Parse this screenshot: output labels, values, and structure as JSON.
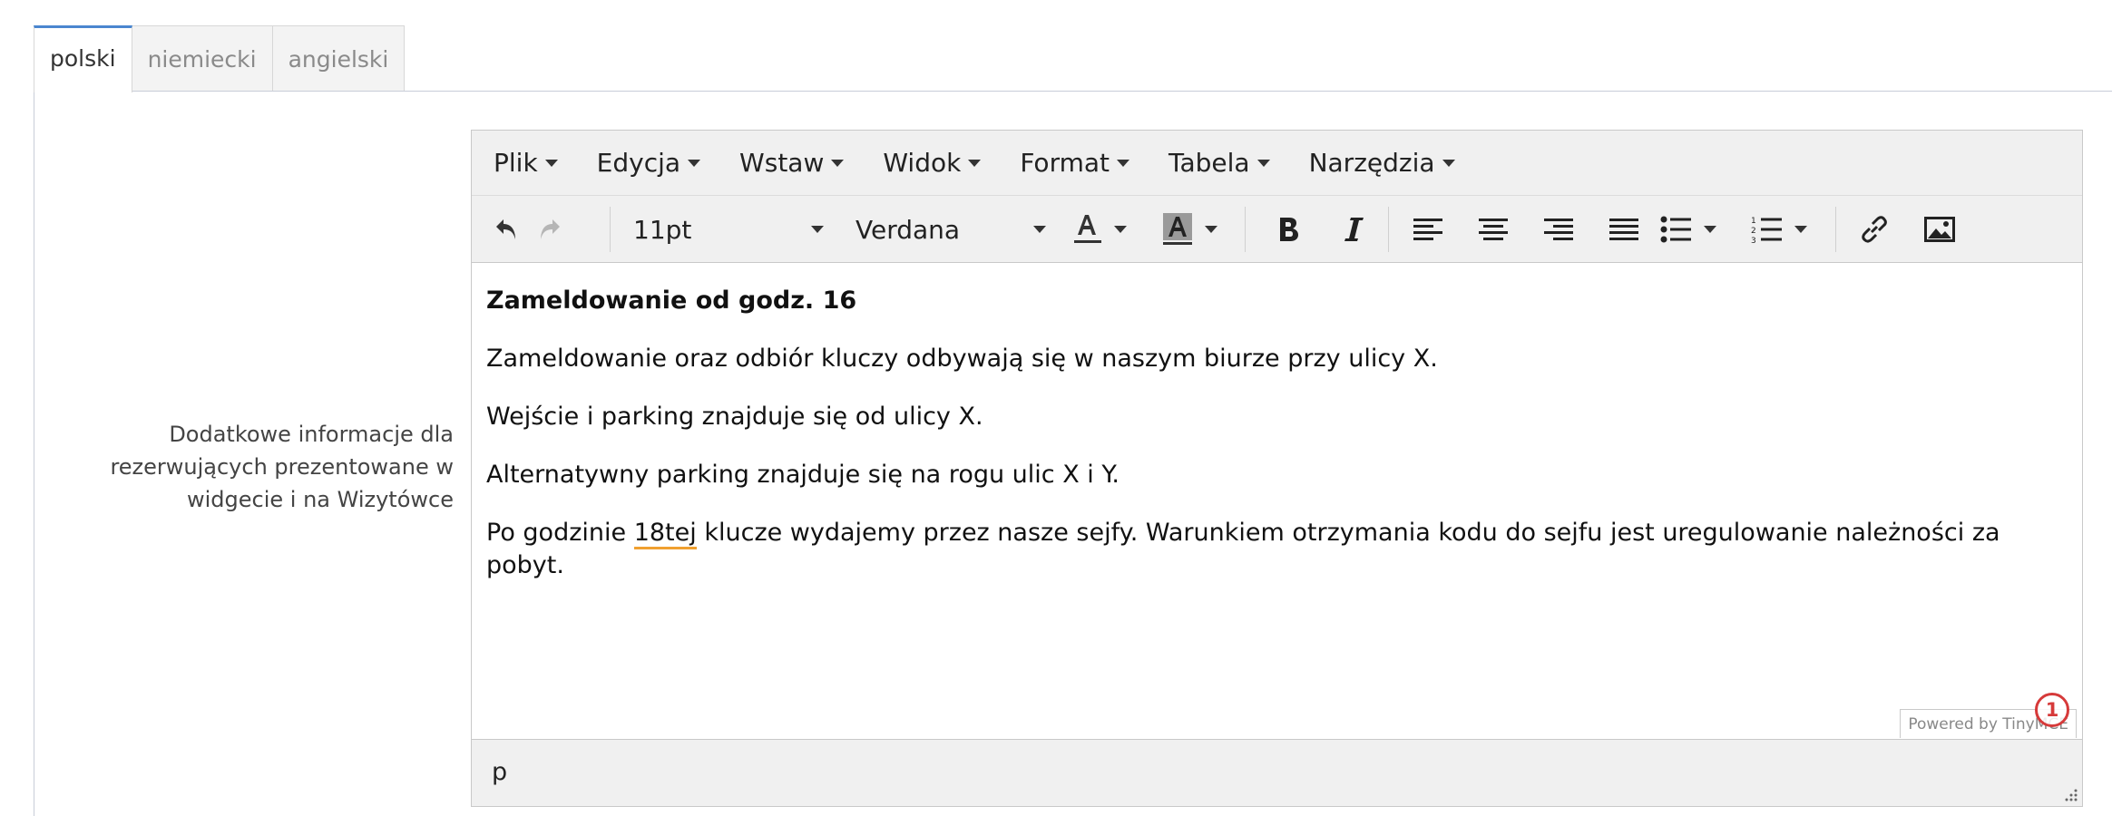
{
  "tabs": [
    {
      "label": "polski",
      "active": true
    },
    {
      "label": "niemiecki",
      "active": false
    },
    {
      "label": "angielski",
      "active": false
    }
  ],
  "field_label": "Dodatkowe informacje dla rezerwujących prezentowane w widgecie i na Wizytówce",
  "editor": {
    "menu": [
      "Plik",
      "Edycja",
      "Wstaw",
      "Widok",
      "Format",
      "Tabela",
      "Narzędzia"
    ],
    "toolbar": {
      "font_size": "11pt",
      "font_family": "Verdana",
      "icons": [
        "undo-icon",
        "redo-icon",
        "text-color-icon",
        "background-color-icon",
        "bold-icon",
        "italic-icon",
        "align-left-icon",
        "align-center-icon",
        "align-right-icon",
        "align-justify-icon",
        "bullet-list-icon",
        "numbered-list-icon",
        "link-icon",
        "image-icon"
      ]
    },
    "content": {
      "heading": "Zameldowanie od godz. 16",
      "p1": "Zameldowanie oraz odbiór kluczy odbywają się w naszym biurze przy ulicy X.",
      "p2": "Wejście i parking znajduje się od ulicy X.",
      "p3": "Alternatywny parking znajduje się na rogu ulic X i Y.",
      "p4_before": "Po godzinie ",
      "p4_misspelled": "18tej",
      "p4_after": " klucze wydajemy przez nasze sejfy. Warunkiem otrzymania kodu do sejfu jest uregulowanie należności za pobyt."
    },
    "status_path": "p",
    "powered_by": "Powered by TinyMCE",
    "notification_count": "1"
  },
  "colors": {
    "accent": "#4a86cf",
    "spellcheck": "#f0a030",
    "badge": "#d63a3a"
  }
}
